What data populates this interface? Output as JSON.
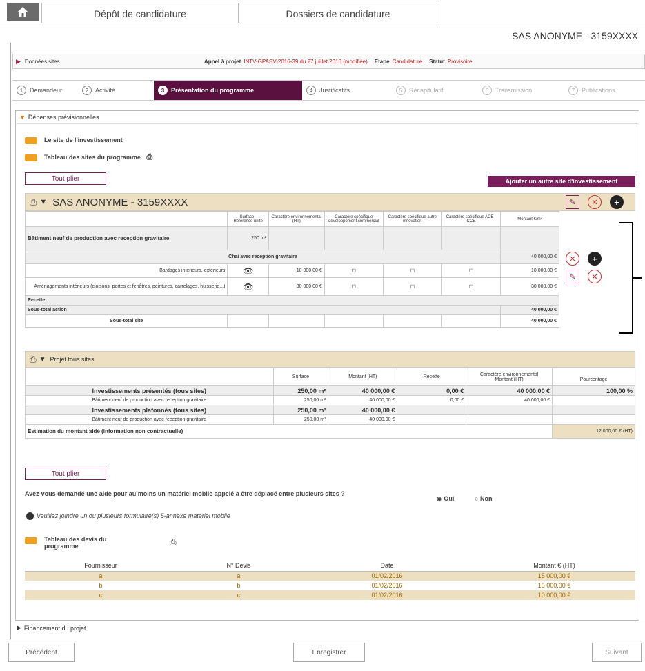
{
  "tabs": {
    "deposit": "Dépôt de candidature",
    "files": "Dossiers de candidature"
  },
  "company": "SAS ANONYME - 3159XXXX",
  "infobar": {
    "section": "Données sites",
    "appel_label": "Appel à projet",
    "appel_value": "INTV-GPASV-2016-39 du 27 juillet 2016 (modifiée)",
    "etape_label": "Etape",
    "etape_value": "Candidature",
    "statut_label": "Statut",
    "statut_value": "Provisoire"
  },
  "steps": [
    {
      "num": "1",
      "label": "Demandeur"
    },
    {
      "num": "2",
      "label": "Activité"
    },
    {
      "num": "3",
      "label": "Présentation du programme"
    },
    {
      "num": "4",
      "label": "Justificatifs"
    },
    {
      "num": "5",
      "label": "Récapitulatif"
    },
    {
      "num": "6",
      "label": "Transmission"
    },
    {
      "num": "7",
      "label": "Publications"
    }
  ],
  "section_title": "Dépenses prévisionnelles",
  "line1": "Le site de l'investissement",
  "line2": "Tableau des sites du programme",
  "tout_plier": "Tout plier",
  "add_site": "Ajouter un autre site d'investissement",
  "site_name": "SAS ANONYME - 3159XXXX",
  "site_headers": [
    "Surface - Référence unité",
    "Caractère environnemental (HT)",
    "Caractère spécifique développement commercial",
    "Caractère spécifique autre innovation",
    "Caractère spécifique ACE - CCE",
    "Montant €/m²"
  ],
  "site_rows": {
    "building": "Bâtiment neuf de production avec reception gravitaire",
    "building_surface": "250 m²",
    "chai": "Chai avec reception gravitaire",
    "chai_amount": "40 000,00 €",
    "item1": "Bardages intérieurs, extérieurs",
    "item1_env": "10 000,00 €",
    "item1_amount": "10 000,00 €",
    "item2": "Aménagements intérieurs (cloisons, portes et fenêtres, peintures, carrelages, huisserie...)",
    "item2_env": "30 000,00 €",
    "item2_amount": "30 000,00 €",
    "recette": "Recette",
    "subtotal_action": "Sous-total action",
    "subtotal_action_value": "40 000,00 €",
    "subtotal_site": "Sous-total site",
    "subtotal_site_value": "40 000,00 €"
  },
  "projet": {
    "title": "Projet tous sites",
    "headers": [
      "Surface",
      "Montant (HT)",
      "Recette",
      "Caractère environnemental",
      "Montant (HT)",
      "Pourcentage"
    ],
    "row1": [
      "Investissements présentés (tous sites)",
      "250,00 m²",
      "40 000,00 €",
      "0,00 €",
      "40 000,00 €",
      "100,00 %"
    ],
    "row2": [
      "Bâtiment neuf de production avec reception gravitaire",
      "250,00 m²",
      "40 000,00 €",
      "0,00 €",
      "40 000,00 €",
      ""
    ],
    "row3": [
      "Investissements plafonnés (tous sites)",
      "250,00 m²",
      "40 000,00 €",
      "",
      "",
      ""
    ],
    "row4": [
      "Bâtiment neuf de production avec reception gravitaire",
      "250,00 m²",
      "40 000,00 €",
      "",
      "",
      ""
    ],
    "estimation": "Estimation du montant aidé (information non contractuelle)",
    "estimation_value": "12 000,00 € (HT)"
  },
  "question": "Avez-vous demandé une aide pour au moins un matériel mobile appelé à être déplacé entre plusieurs sites ?",
  "oui": "Oui",
  "non": "Non",
  "info_note": "Veuillez joindre un ou plusieurs formulaire(s) 5-annexe matériel mobile",
  "devis_title": "Tableau des devis du programme",
  "devis_headers": [
    "Fournisseur",
    "N° Devis",
    "Date",
    "Montant € (HT)"
  ],
  "devis_rows": [
    [
      "a",
      "a",
      "01/02/2016",
      "15 000,00 €"
    ],
    [
      "b",
      "b",
      "01/02/2016",
      "15 000,00 €"
    ],
    [
      "c",
      "c",
      "01/02/2016",
      "10 000,00 €"
    ]
  ],
  "financement": "Financement du projet",
  "nav": {
    "prev": "Précédent",
    "save": "Enregistrer",
    "next": "Suivant"
  }
}
